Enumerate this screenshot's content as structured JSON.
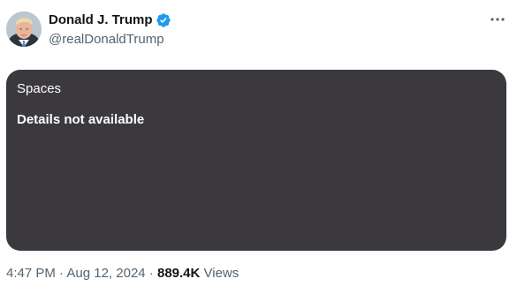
{
  "author": {
    "display_name": "Donald J. Trump",
    "handle": "@realDonaldTrump",
    "verified_icon": "verified-badge-icon",
    "avatar": "profile-photo"
  },
  "menu": {
    "icon": "more-horizontal-icon"
  },
  "space_card": {
    "label": "Spaces",
    "title": "Details not available",
    "background_color": "#3c393e"
  },
  "meta": {
    "time": "4:47 PM",
    "separator_1": " · ",
    "date": "Aug 12, 2024",
    "separator_2": " · ",
    "views_count": "889.4K",
    "views_label": " Views"
  },
  "colors": {
    "verified": "#1d9bf0",
    "secondary_text": "#536471",
    "primary_text": "#0f1419"
  }
}
